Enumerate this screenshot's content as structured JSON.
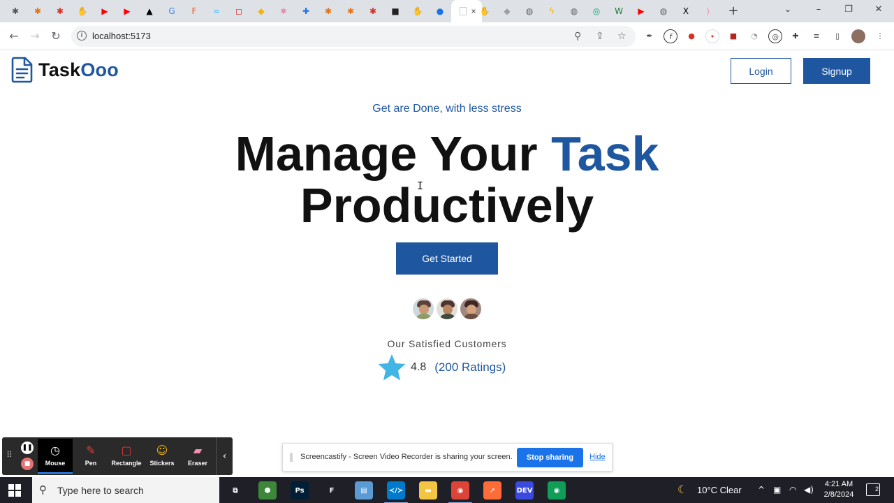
{
  "browser": {
    "tabs": [
      {
        "icon": "asterisk-icon",
        "glyph": "✱",
        "color": "#555555"
      },
      {
        "icon": "orange-asterisk-icon",
        "glyph": "✱",
        "color": "#e8710a"
      },
      {
        "icon": "orange-asterisk-icon",
        "glyph": "✱",
        "color": "#d93025"
      },
      {
        "icon": "hand-icon",
        "glyph": "✋",
        "color": "#f4b400"
      },
      {
        "icon": "youtube-icon",
        "glyph": "▶",
        "color": "#ff0000"
      },
      {
        "icon": "youtube-icon",
        "glyph": "▶",
        "color": "#ff0000"
      },
      {
        "icon": "triangle-logo-icon",
        "glyph": "▲",
        "color": "#000000"
      },
      {
        "icon": "google-icon",
        "glyph": "G",
        "color": "#4285f4"
      },
      {
        "icon": "figma-icon",
        "glyph": "F",
        "color": "#f24e1e"
      },
      {
        "icon": "wave-icon",
        "glyph": "≈",
        "color": "#38bdf8"
      },
      {
        "icon": "square-logo-icon",
        "glyph": "◻",
        "color": "#d93025"
      },
      {
        "icon": "shield-logo-icon",
        "glyph": "◆",
        "color": "#f4b400"
      },
      {
        "icon": "react-atom-icon",
        "glyph": "⚛",
        "color": "#e91e63"
      },
      {
        "icon": "puzzle-icon",
        "glyph": "✚",
        "color": "#1a73e8"
      },
      {
        "icon": "orange-asterisk-icon",
        "glyph": "✱",
        "color": "#e8710a"
      },
      {
        "icon": "orange-asterisk-icon",
        "glyph": "✱",
        "color": "#e8710a"
      },
      {
        "icon": "orange-asterisk-icon",
        "glyph": "✱",
        "color": "#d93025"
      },
      {
        "icon": "dark-square-icon",
        "glyph": "■",
        "color": "#222222"
      },
      {
        "icon": "hand-icon",
        "glyph": "✋",
        "color": "#f4b400"
      },
      {
        "icon": "blue-circle-icon",
        "glyph": "●",
        "color": "#1a73e8"
      },
      {
        "icon": "hand-icon",
        "glyph": "✋",
        "color": "#f4b400"
      },
      {
        "icon": "diamond-icon",
        "glyph": "◆",
        "color": "#9e9e9e"
      },
      {
        "icon": "globe-icon",
        "glyph": "◍",
        "color": "#5f6368"
      },
      {
        "icon": "bolt-icon",
        "glyph": "ϟ",
        "color": "#f4b400"
      },
      {
        "icon": "globe-icon",
        "glyph": "◍",
        "color": "#5f6368"
      },
      {
        "icon": "chatgpt-icon",
        "glyph": "◎",
        "color": "#10a37f"
      },
      {
        "icon": "w-logo-icon",
        "glyph": "W",
        "color": "#188038"
      },
      {
        "icon": "youtube-icon",
        "glyph": "▶",
        "color": "#ff0000"
      },
      {
        "icon": "globe-icon",
        "glyph": "◍",
        "color": "#5f6368"
      },
      {
        "icon": "x-logo-icon",
        "glyph": "X",
        "color": "#000000"
      },
      {
        "icon": "pink-arrow-icon",
        "glyph": "⟩",
        "color": "#f48fb1"
      }
    ],
    "active_tab_icon": "blank-page-icon",
    "active_tab_close": "×",
    "new_tab_glyph": "+",
    "url": "localhost:5173"
  },
  "header": {
    "logo_icon": "document-icon",
    "logo_part1": "Task",
    "logo_part2": "Ooo",
    "login_label": "Login",
    "signup_label": "Signup"
  },
  "hero": {
    "tagline": "Get are Done, with less stress",
    "headline_part1": "Manage Your ",
    "headline_accent": "Task",
    "headline_line2": "Productively",
    "cta_label": "Get Started",
    "customers_label": "Our Satisfied Customers",
    "rating_value": "4.8",
    "rating_count": "(200 Ratings)",
    "rating_star_color": "#41b6e6"
  },
  "screencastify": {
    "tools": [
      {
        "label": "Mouse",
        "icon": "mouse-icon",
        "glyph": "◷",
        "active": true
      },
      {
        "label": "Pen",
        "icon": "pen-icon",
        "glyph": "✎",
        "active": false
      },
      {
        "label": "Rectangle",
        "icon": "rectangle-icon",
        "glyph": "▢",
        "active": false
      },
      {
        "label": "Stickers",
        "icon": "sticker-icon",
        "glyph": "☺",
        "active": false
      },
      {
        "label": "Eraser",
        "icon": "eraser-icon",
        "glyph": "▰",
        "active": false
      }
    ],
    "share_message": "Screencastify - Screen Video Recorder is sharing your screen.",
    "stop_label": "Stop sharing",
    "hide_label": "Hide"
  },
  "taskbar": {
    "search_placeholder": "Type here to search",
    "weather": "10°C  Clear",
    "time": "4:21 AM",
    "date": "2/8/2024",
    "notifications": "2",
    "apps": [
      {
        "icon": "task-view-icon",
        "label": "⧉",
        "color": "#1f1f28"
      },
      {
        "icon": "node-icon",
        "label": "⬢",
        "color": "#3c873a"
      },
      {
        "icon": "photoshop-icon",
        "label": "Ps",
        "color": "#001e36"
      },
      {
        "icon": "figma-icon",
        "label": "F",
        "color": "#1f1f28"
      },
      {
        "icon": "notes-icon",
        "label": "▤",
        "color": "#5b9bd5"
      },
      {
        "icon": "vscode-icon",
        "label": "≺/≻",
        "color": "#007acc"
      },
      {
        "icon": "file-explorer-icon",
        "label": "▬",
        "color": "#f4c542"
      },
      {
        "icon": "chrome-icon",
        "label": "◉",
        "color": "#db4437"
      },
      {
        "icon": "postman-icon",
        "label": "➚",
        "color": "#ff6c37"
      },
      {
        "icon": "dev-icon",
        "label": "DEV",
        "color": "#3b49df"
      },
      {
        "icon": "chrome-profile-icon",
        "label": "◉",
        "color": "#0f9d58"
      }
    ]
  }
}
